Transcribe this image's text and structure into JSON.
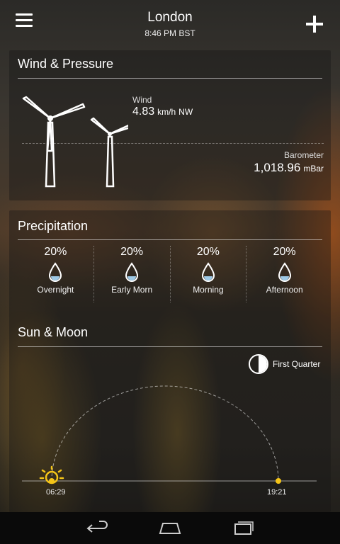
{
  "header": {
    "location": "London",
    "time": "8:46 PM BST"
  },
  "wind_pressure": {
    "title": "Wind & Pressure",
    "wind_label": "Wind",
    "wind_speed": "4.83",
    "wind_unit": "km/h",
    "wind_direction": "NW",
    "barometer_label": "Barometer",
    "barometer_value": "1,018.96",
    "barometer_unit": "mBar"
  },
  "precipitation": {
    "title": "Precipitation",
    "periods": [
      {
        "label": "Overnight",
        "chance": "20%"
      },
      {
        "label": "Early Morn",
        "chance": "20%"
      },
      {
        "label": "Morning",
        "chance": "20%"
      },
      {
        "label": "Afternoon",
        "chance": "20%"
      }
    ]
  },
  "sun_moon": {
    "title": "Sun & Moon",
    "moon_phase": "First Quarter",
    "sunrise": "06:29",
    "sunset": "19:21",
    "sun_color": "#f5c518"
  },
  "icons": [
    "menu-icon",
    "add-icon",
    "wind-turbine-icon",
    "raindrop-icon",
    "moon-phase-icon",
    "sun-icon",
    "back-icon",
    "home-icon",
    "recent-apps-icon"
  ]
}
